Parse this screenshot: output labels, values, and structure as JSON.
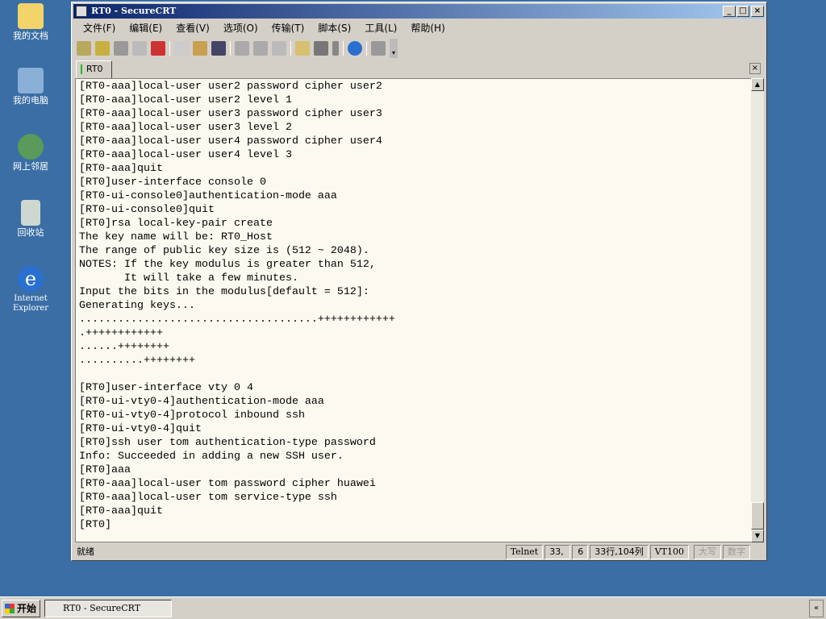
{
  "desktop": {
    "icons": [
      "我的文档",
      "我的电脑",
      "网上邻居",
      "回收站",
      "Internet Explorer"
    ]
  },
  "window": {
    "title": "RT0 - SecureCRT",
    "controls": [
      "_",
      "□",
      "×"
    ]
  },
  "menu": [
    "文件(F)",
    "编辑(E)",
    "查看(V)",
    "选项(O)",
    "传输(T)",
    "脚本(S)",
    "工具(L)",
    "帮助(H)"
  ],
  "toolbar": [
    "connect-icon",
    "quick-connect-icon",
    "connect-tab-icon",
    "reconnect-icon",
    "disconnect-icon",
    "copy-icon",
    "paste-icon",
    "find-icon",
    "print-icon",
    "print-selection-icon",
    "printer-setup-icon",
    "session-options-icon",
    "global-options-icon",
    "keymap-icon",
    "help-icon",
    "sftp-icon"
  ],
  "tab": {
    "label": "RT0",
    "close": "×"
  },
  "terminal": {
    "lines": [
      "[RT0-aaa]local-user user2 password cipher user2",
      "[RT0-aaa]local-user user2 level 1",
      "[RT0-aaa]local-user user3 password cipher user3",
      "[RT0-aaa]local-user user3 level 2",
      "[RT0-aaa]local-user user4 password cipher user4",
      "[RT0-aaa]local-user user4 level 3",
      "[RT0-aaa]quit",
      "[RT0]user-interface console 0",
      "[RT0-ui-console0]authentication-mode aaa",
      "[RT0-ui-console0]quit",
      "[RT0]rsa local-key-pair create",
      "The key name will be: RT0_Host",
      "The range of public key size is (512 ~ 2048).",
      "NOTES: If the key modulus is greater than 512,",
      "       It will take a few minutes.",
      "Input the bits in the modulus[default = 512]:",
      "Generating keys...",
      ".....................................++++++++++++",
      ".++++++++++++",
      "......++++++++",
      "..........++++++++",
      "",
      "[RT0]user-interface vty 0 4",
      "[RT0-ui-vty0-4]authentication-mode aaa",
      "[RT0-ui-vty0-4]protocol inbound ssh",
      "[RT0-ui-vty0-4]quit",
      "[RT0]ssh user tom authentication-type password",
      "Info: Succeeded in adding a new SSH user.",
      "[RT0]aaa",
      "[RT0-aaa]local-user tom password cipher huawei",
      "[RT0-aaa]local-user tom service-type ssh",
      "[RT0-aaa]quit",
      "[RT0]"
    ]
  },
  "status": {
    "ready": "就绪",
    "protocol": "Telnet",
    "row": "33,",
    "col": "6",
    "position": "33行,104列",
    "emulation": "VT100",
    "caps": "大写",
    "num": "数字"
  },
  "taskbar": {
    "start": "开始",
    "task": "RT0 - SecureCRT",
    "tray": "«"
  }
}
